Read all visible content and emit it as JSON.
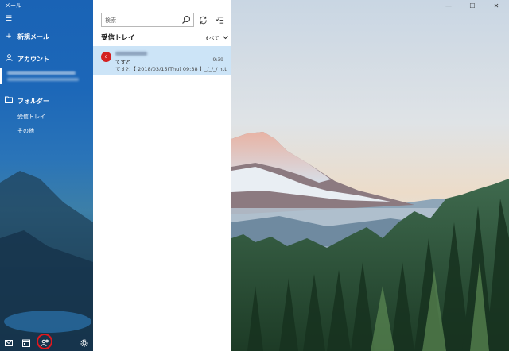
{
  "window": {
    "title": "メール",
    "minimize": "—",
    "maximize": "☐",
    "close": "✕"
  },
  "sidebar": {
    "menu_icon": "hamburger-menu-icon",
    "new_mail": "新規メール",
    "accounts_heading": "アカウント",
    "folders_heading": "フォルダー",
    "folders": [
      {
        "label": "受信トレイ"
      },
      {
        "label": "その他"
      }
    ],
    "bottom_icons": [
      "mail-icon",
      "calendar-icon",
      "people-icon",
      "settings-icon"
    ],
    "highlight_color": "#e0181e",
    "accent": "#1a63b5"
  },
  "list": {
    "search_placeholder": "検索",
    "folder_title": "受信トレイ",
    "filter_label": "すべて",
    "messages": [
      {
        "avatar_letter": "c",
        "subject": "てすと",
        "preview": "てすと【 2018/03/15(Thu) 09:38 】_/_/_/ htt",
        "time": "9:39",
        "avatar_color": "#d42121"
      }
    ]
  }
}
